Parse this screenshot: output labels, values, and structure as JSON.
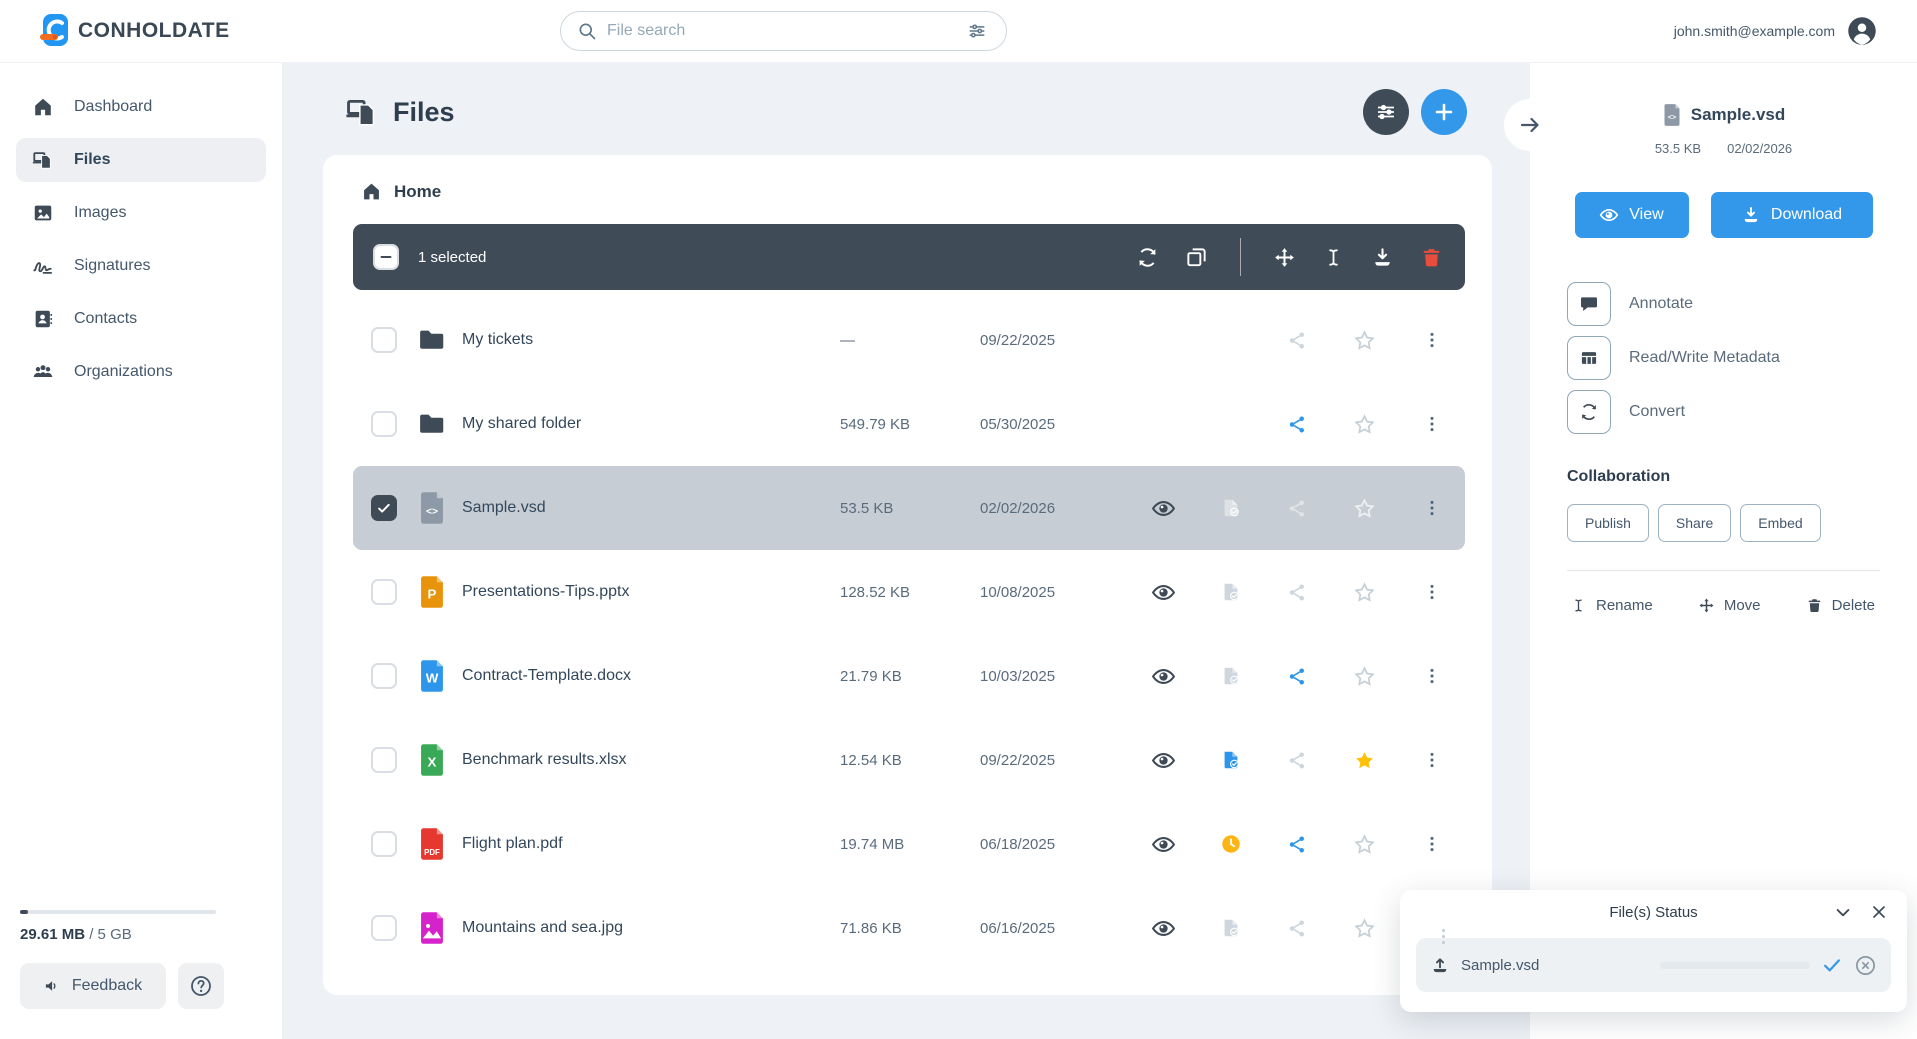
{
  "topbar": {
    "brand": "CONHOLDATE",
    "search_placeholder": "File search",
    "user_email": "john.smith@example.com"
  },
  "sidebar": {
    "items": [
      {
        "label": "Dashboard",
        "icon": "home",
        "active": false
      },
      {
        "label": "Files",
        "icon": "files",
        "active": true
      },
      {
        "label": "Images",
        "icon": "image",
        "active": false
      },
      {
        "label": "Signatures",
        "icon": "signature",
        "active": false
      },
      {
        "label": "Contacts",
        "icon": "contacts",
        "active": false
      },
      {
        "label": "Organizations",
        "icon": "people",
        "active": false
      }
    ],
    "storage_used": "29.61 MB",
    "storage_total": "/ 5 GB",
    "feedback_label": "Feedback"
  },
  "main": {
    "title": "Files",
    "breadcrumb": "Home",
    "selection_label": "1 selected",
    "toolbar_actions": [
      {
        "icon": "refresh"
      },
      {
        "icon": "duplicate"
      },
      {
        "icon": "divider"
      },
      {
        "icon": "move"
      },
      {
        "icon": "rename"
      },
      {
        "icon": "download"
      },
      {
        "icon": "trash",
        "danger": true
      }
    ],
    "rows": [
      {
        "name": "My tickets",
        "type": "folder",
        "size": "—",
        "date": "09/22/2025",
        "preview": false,
        "doc": "none",
        "share": "gray",
        "star": "outline",
        "selected": false,
        "checked": false
      },
      {
        "name": "My shared folder",
        "type": "folder",
        "size": "549.79 KB",
        "date": "05/30/2025",
        "preview": false,
        "doc": "none",
        "share": "blue",
        "star": "outline",
        "selected": false,
        "checked": false
      },
      {
        "name": "Sample.vsd",
        "type": "vsd",
        "size": "53.5 KB",
        "date": "02/02/2026",
        "preview": true,
        "doc": "light",
        "share": "light",
        "star": "light",
        "selected": true,
        "checked": true
      },
      {
        "name": "Presentations-Tips.pptx",
        "type": "pptx",
        "size": "128.52 KB",
        "date": "10/08/2025",
        "preview": true,
        "doc": "gray",
        "share": "gray",
        "star": "outline",
        "selected": false,
        "checked": false
      },
      {
        "name": "Contract-Template.docx",
        "type": "docx",
        "size": "21.79 KB",
        "date": "10/03/2025",
        "preview": true,
        "doc": "gray",
        "share": "blue",
        "star": "outline",
        "selected": false,
        "checked": false
      },
      {
        "name": "Benchmark results.xlsx",
        "type": "xlsx",
        "size": "12.54 KB",
        "date": "09/22/2025",
        "preview": true,
        "doc": "blue",
        "share": "gray",
        "star": "filled",
        "selected": false,
        "checked": false
      },
      {
        "name": "Flight plan.pdf",
        "type": "pdf",
        "size": "19.74 MB",
        "date": "06/18/2025",
        "preview": true,
        "doc": "clock",
        "share": "blue",
        "star": "outline",
        "selected": false,
        "checked": false
      },
      {
        "name": "Mountains and sea.jpg",
        "type": "jpg",
        "size": "71.86 KB",
        "date": "06/16/2025",
        "preview": true,
        "doc": "gray",
        "share": "gray",
        "star": "outline",
        "selected": false,
        "checked": false
      }
    ],
    "file_type_colors": {
      "folder": "#3e4a56",
      "vsd": "#8d99a6",
      "pptx": "#e8930c",
      "docx": "#2e96ea",
      "xlsx": "#3aa957",
      "pdf": "#e5392f",
      "jpg": "#d622cb"
    },
    "file_type_badges": {
      "vsd": "<>",
      "pptx": "P",
      "docx": "W",
      "xlsx": "X",
      "pdf": "PDF",
      "jpg": ""
    }
  },
  "detail": {
    "file_name": "Sample.vsd",
    "file_size": "53.5 KB",
    "file_date": "02/02/2026",
    "view_label": "View",
    "download_label": "Download",
    "actions": [
      {
        "label": "Annotate",
        "icon": "annotate"
      },
      {
        "label": "Read/Write Metadata",
        "icon": "metadata"
      },
      {
        "label": "Convert",
        "icon": "convert"
      }
    ],
    "collaboration_title": "Collaboration",
    "collab_buttons": [
      "Publish",
      "Share",
      "Embed"
    ],
    "manage": [
      {
        "label": "Rename",
        "icon": "rename"
      },
      {
        "label": "Move",
        "icon": "move"
      },
      {
        "label": "Delete",
        "icon": "trash"
      }
    ]
  },
  "popup": {
    "title": "File(s) Status",
    "file_name": "Sample.vsd",
    "progress_percent": 100
  },
  "colors": {
    "accent_blue": "#3498ea",
    "toolbar_dark": "#3f4b57",
    "selected_row": "#c6cdd4",
    "star_yellow": "#ffc107",
    "pending_yellow": "#fdb515",
    "danger_red": "#e74c3c",
    "share_blue": "#2e96ea"
  }
}
